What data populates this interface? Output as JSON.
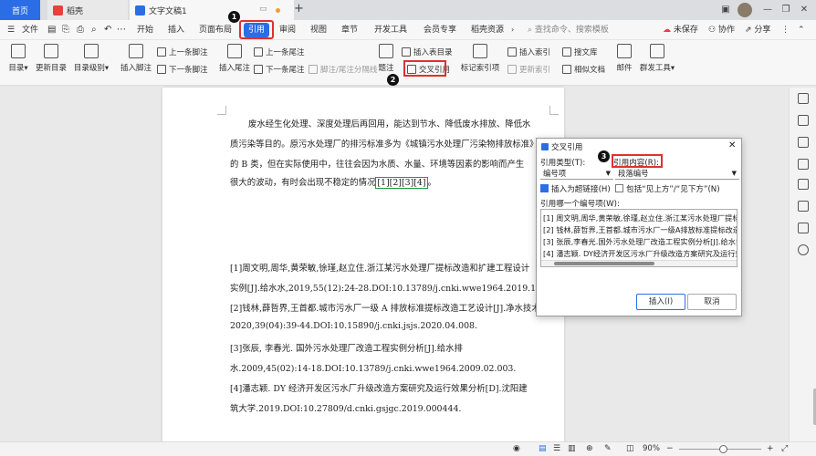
{
  "tabs": {
    "home": "首页",
    "daoke": "稻壳",
    "doc": "文字文稿1",
    "add": "+"
  },
  "menubar": {
    "file": "文件",
    "items": [
      "开始",
      "插入",
      "页面布局",
      "引用",
      "审阅",
      "视图",
      "章节",
      "开发工具",
      "会员专享",
      "稻壳资源"
    ],
    "search": "查找命令、搜索模板",
    "unsaved": "未保存",
    "collab": "协作",
    "share": "分享"
  },
  "ribbon": {
    "toc": "目录",
    "update_toc": "更新目录",
    "toc_level": "目录级别",
    "insert_footnote": "插入脚注",
    "prev_footnote": "上一条脚注",
    "next_footnote": "下一条脚注",
    "insert_endnote": "插入尾注",
    "prev_endnote": "上一条尾注",
    "next_endnote": "下一条尾注",
    "footnote_sep": "脚注/尾注分隔线",
    "caption": "题注",
    "insert_table_caption": "插入表目录",
    "cross_ref": "交叉引用",
    "mark_index": "标记索引项",
    "insert_index": "插入索引",
    "update_index": "更新索引",
    "search_lit": "搜文库",
    "similar_docs": "相似文档",
    "mail": "邮件",
    "mass_tools": "群发工具"
  },
  "badges": [
    "1",
    "2",
    "3"
  ],
  "document": {
    "para1": [
      "废水经生化处理、深度处理后再回用，能达到节水、降低废水排放、降低水",
      "质污染等目的。原污水处理厂的排污标准多为《城镇污水处理厂污染物排放标准》",
      "的 B 类，但在实际使用中，往往会因为水质、水量、环境等因素的影响而产生",
      "很大的波动，有时会出现不稳定的情况"
    ],
    "cite": "[1][2][3][4]",
    "cite_end": "。",
    "refs": [
      "[1]周文明,周华,黄荣敏,徐瑾,赵立住.浙江某污水处理厂提标改造和扩建工程设计",
      "实例[J].给水水,2019,55(12):24-28.DOI:10.13789/j.cnki.wwe1964.2019.12.005.",
      "[2]钱林,薛哲界,王首都.城市污水厂一级 A 排放标准提标改造工艺设计[J].净水技术,",
      "2020,39(04):39-44.DOI:10.15890/j.cnki.jsjs.2020.04.008.",
      "[3]张辰, 李春光. 国外污水处理厂改造工程实例分析[J].给水排",
      "水.2009,45(02):14-18.DOI:10.13789/j.cnki.wwe1964.2009.02.003.",
      "[4]潘志颖. DY 经济开发区污水厂升级改造方案研究及运行效果分析[D].沈阳建",
      "筑大学.2019.DOI:10.27809/d.cnki.gsjgc.2019.000444."
    ]
  },
  "dialog": {
    "title": "交叉引用",
    "ref_type_label": "引用类型(T):",
    "ref_type_value": "编号项",
    "ref_content_label": "引用内容(R):",
    "ref_content_value": "段落编号",
    "insert_hyperlink": "插入为超链接(H)",
    "include_above_below": "包括“见上方”/“见下方”(N)",
    "list_label": "引用哪一个编号项(W):",
    "items": [
      "[1] 周文明,周华,黄荣敏,徐瑾,赵立住.浙江某污水处理厂提标",
      "[2] 钱林,薛哲界,王首都.城市污水厂一级A排放标准提标改造",
      "[3] 张辰,李春光.国外污水处理厂改造工程实例分析[J].给水排",
      "[4] 潘志颖. DY经济开发区污水厂升级改造方案研究及运行效"
    ],
    "insert_btn": "插入(I)",
    "cancel_btn": "取消"
  },
  "status": {
    "zoom": "90%"
  },
  "colors": {
    "accent": "#2b6de5",
    "highlight_red": "#e03030",
    "cite_green": "#1f9a3b"
  }
}
